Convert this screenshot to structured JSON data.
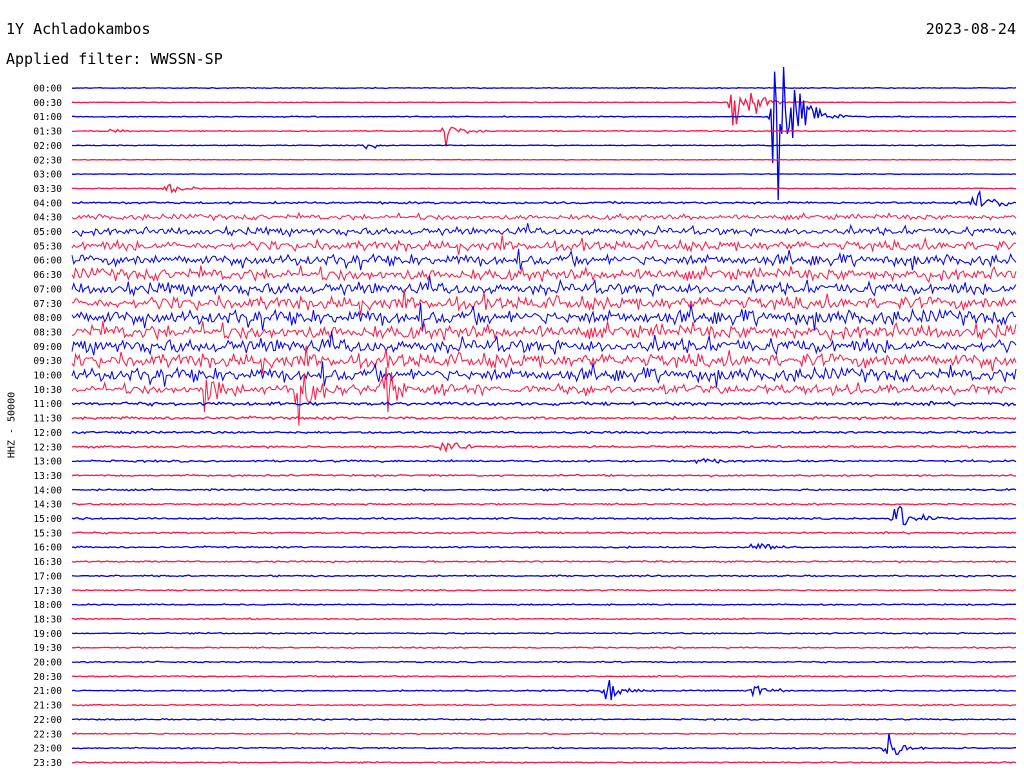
{
  "header": {
    "station": "1Y Achladokambos",
    "date": "2023-08-24",
    "filter": "Applied filter: WWSSN-SP"
  },
  "chart_data": {
    "type": "line",
    "title": "1Y Achladokambos",
    "subtitle": "Applied filter: WWSSN-SP",
    "ylabel": "HHZ - 50000",
    "xlabel": "",
    "x_range_minutes": [
      0,
      30
    ],
    "y_ticks": [
      "00:00",
      "00:30",
      "01:00",
      "01:30",
      "02:00",
      "02:30",
      "03:00",
      "03:30",
      "04:00",
      "04:30",
      "05:00",
      "05:30",
      "06:00",
      "06:30",
      "07:00",
      "07:30",
      "08:00",
      "08:30",
      "09:00",
      "09:30",
      "10:00",
      "10:30",
      "11:00",
      "11:30",
      "12:00",
      "12:30",
      "13:00",
      "13:30",
      "14:00",
      "14:30",
      "15:00",
      "15:30",
      "16:00",
      "16:30",
      "17:00",
      "17:30",
      "18:00",
      "18:30",
      "19:00",
      "19:30",
      "20:00",
      "20:30",
      "21:00",
      "21:30",
      "22:00",
      "22:30",
      "23:00",
      "23:30"
    ],
    "colors": {
      "even_hour_rows": "#0000ee",
      "half_hour_rows": "#ff1744",
      "background": "#ffffff"
    },
    "noise_level": [
      0.4,
      0.3,
      0.5,
      0.5,
      0.4,
      0.3,
      0.3,
      0.4,
      1.0,
      2.5,
      3.5,
      4.5,
      5.0,
      5.5,
      5.5,
      6.0,
      6.5,
      6.5,
      6.5,
      6.5,
      6.0,
      4.0,
      1.6,
      1.2,
      1.0,
      1.0,
      0.9,
      0.8,
      0.8,
      0.8,
      0.8,
      0.8,
      0.7,
      0.7,
      0.7,
      0.6,
      0.6,
      0.6,
      0.6,
      0.6,
      0.6,
      0.6,
      0.6,
      0.6,
      0.6,
      0.6,
      0.6,
      0.6
    ],
    "events": [
      {
        "row": "00:30",
        "t": 0.7,
        "amp": 45
      },
      {
        "row": "01:00",
        "t": 0.742,
        "amp": 120
      },
      {
        "row": "01:00",
        "t": 0.77,
        "amp": 12
      },
      {
        "row": "01:30",
        "t": 0.04,
        "amp": 5
      },
      {
        "row": "01:30",
        "t": 0.395,
        "amp": 12
      },
      {
        "row": "02:00",
        "t": 0.31,
        "amp": 4
      },
      {
        "row": "03:30",
        "t": 0.1,
        "amp": 6
      },
      {
        "row": "04:00",
        "t": 0.955,
        "amp": 22
      },
      {
        "row": "10:30",
        "t": 0.14,
        "amp": 30
      },
      {
        "row": "10:30",
        "t": 0.24,
        "amp": 42
      },
      {
        "row": "10:30",
        "t": 0.33,
        "amp": 35
      },
      {
        "row": "12:30",
        "t": 0.39,
        "amp": 12
      },
      {
        "row": "13:00",
        "t": 0.66,
        "amp": 7
      },
      {
        "row": "15:00",
        "t": 0.87,
        "amp": 20
      },
      {
        "row": "16:00",
        "t": 0.72,
        "amp": 8
      },
      {
        "row": "21:00",
        "t": 0.565,
        "amp": 14
      },
      {
        "row": "21:00",
        "t": 0.72,
        "amp": 10
      },
      {
        "row": "23:00",
        "t": 0.862,
        "amp": 18
      }
    ]
  }
}
